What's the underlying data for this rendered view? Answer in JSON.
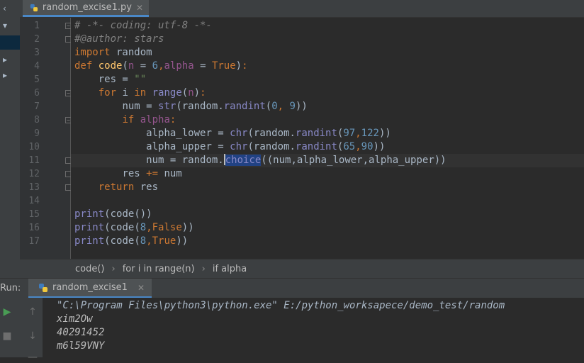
{
  "editor": {
    "tab_title": "random_excise1.py",
    "lines": [
      "1",
      "2",
      "3",
      "4",
      "5",
      "6",
      "7",
      "8",
      "9",
      "10",
      "11",
      "12",
      "13",
      "14",
      "15",
      "16",
      "17"
    ],
    "code": {
      "l1": "# -*- coding: utf-8 -*-",
      "l2": "#@author: stars",
      "l3a": "import",
      "l3b": " random",
      "l4a": "def",
      "l4b": "code",
      "l4c": "n",
      "l4d": "6",
      "l4e": "alpha",
      "l4f": "True",
      "l5a": "res = ",
      "l5b": "\"\"",
      "l6a": "for",
      "l6b": " i ",
      "l6c": "in",
      "l6d": "range",
      "l6e": "n",
      "l7a": "num = ",
      "l7b": "str",
      "l7c": "(random.",
      "l7d": "randint",
      "l7e": "0",
      "l7f": "9",
      "l8a": "if",
      "l8b": "alpha",
      "l9a": "alpha_lower = ",
      "l9b": "chr",
      "l9c": "(random.",
      "l9d": "randint",
      "l9e": "97",
      "l9f": "122",
      "l10a": "alpha_upper = ",
      "l10b": "chr",
      "l10c": "(random.",
      "l10d": "randint",
      "l10e": "65",
      "l10f": "90",
      "l11a": "num = random.",
      "l11b": "choice",
      "l11c": "((num,alpha_lower,alpha_upper))",
      "l12a": "res ",
      "l12b": "+=",
      "l12c": " num",
      "l13a": "return",
      "l13b": " res",
      "l15a": "print",
      "l15b": "code",
      "l16a": "print",
      "l16b": "code",
      "l16c": "8",
      "l16d": "False",
      "l17a": "print",
      "l17b": "code",
      "l17c": "8",
      "l17d": "True"
    }
  },
  "breadcrumbs": [
    "code()",
    "for i in range(n)",
    "if alpha"
  ],
  "breadcrumb_separator": "›",
  "run": {
    "label": "Run:",
    "tab_title": "random_excise1",
    "console": [
      "\"C:\\Program Files\\python3\\python.exe\" E:/python_worksapece/demo_test/random",
      "xim2Ow",
      "40291452",
      "m6l59VNY"
    ]
  },
  "colors": {
    "keyword": "#cc7832",
    "function": "#ffc66d",
    "string": "#6a8759",
    "number": "#6897bb",
    "accent": "#4a88c7"
  }
}
